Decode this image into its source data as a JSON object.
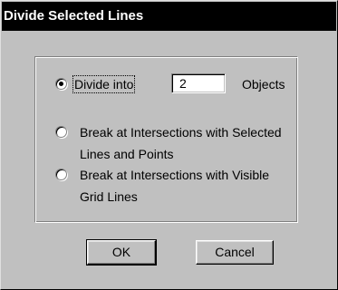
{
  "window": {
    "title": "Divide Selected Lines"
  },
  "options": [
    {
      "label": "Divide into",
      "selected": true
    },
    {
      "label_line1": "Break at Intersections with Selected",
      "label_line2": "Lines and Points",
      "selected": false
    },
    {
      "label_line1": "Break at Intersections with Visible",
      "label_line2": "Grid Lines",
      "selected": false
    }
  ],
  "divide": {
    "value": "2",
    "unit_label": "Objects"
  },
  "buttons": {
    "ok": "OK",
    "cancel": "Cancel"
  }
}
